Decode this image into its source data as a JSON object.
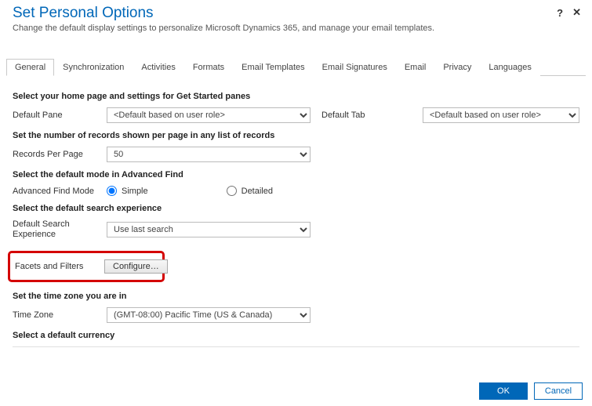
{
  "header": {
    "title": "Set Personal Options",
    "subtitle": "Change the default display settings to personalize Microsoft Dynamics 365, and manage your email templates.",
    "help": "?",
    "close": "✕"
  },
  "tabs": {
    "general": "General",
    "sync": "Synchronization",
    "activities": "Activities",
    "formats": "Formats",
    "email_templates": "Email Templates",
    "email_signatures": "Email Signatures",
    "email": "Email",
    "privacy": "Privacy",
    "languages": "Languages"
  },
  "sections": {
    "homepage_head": "Select your home page and settings for Get Started panes",
    "default_pane_label": "Default Pane",
    "default_pane_value": "<Default based on user role>",
    "default_tab_label": "Default Tab",
    "default_tab_value": "<Default based on user role>",
    "records_head": "Set the number of records shown per page in any list of records",
    "records_label": "Records Per Page",
    "records_value": "50",
    "advfind_head": "Select the default mode in Advanced Find",
    "advfind_label": "Advanced Find Mode",
    "advfind_simple": "Simple",
    "advfind_detailed": "Detailed",
    "search_head": "Select the default search experience",
    "search_label": "Default Search Experience",
    "search_value": "Use last search",
    "facets_label": "Facets and Filters",
    "configure_btn": "Configure…",
    "timezone_head": "Set the time zone you are in",
    "timezone_label": "Time Zone",
    "timezone_value": "(GMT-08:00) Pacific Time (US & Canada)",
    "currency_head": "Select a default currency"
  },
  "footer": {
    "ok": "OK",
    "cancel": "Cancel"
  }
}
